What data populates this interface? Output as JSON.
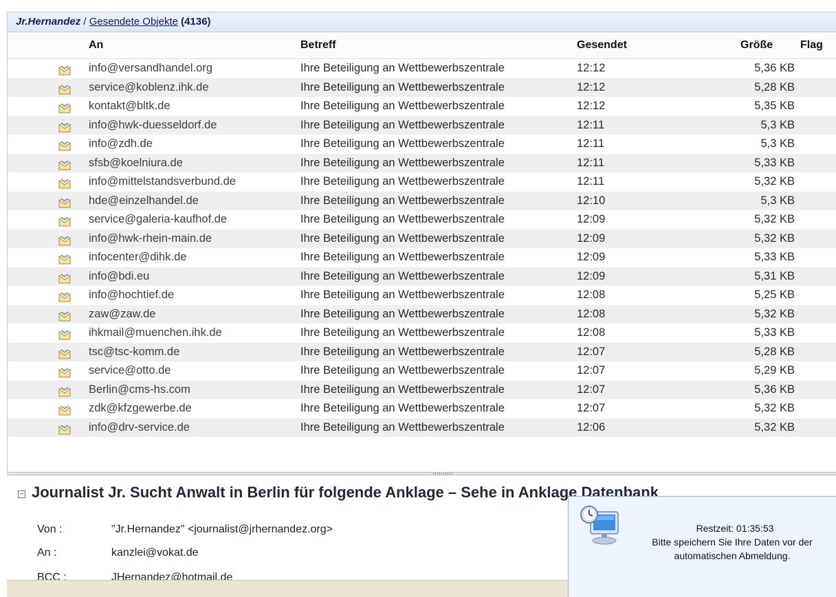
{
  "topbar": {
    "user": "Jr.Hernandez",
    "separator": " / ",
    "folder": "Gesendete Objekte",
    "count": "(4136)"
  },
  "columns": {
    "to": "An",
    "subject": "Betreff",
    "sent": "Gesendet",
    "size": "Größe",
    "flag": "Flag"
  },
  "messages": [
    {
      "to": "info@versandhandel.org",
      "subject": "Ihre Beteiligung an Wettbewerbszentrale",
      "sent": "12:12",
      "size": "5,36 KB"
    },
    {
      "to": "service@koblenz.ihk.de",
      "subject": "Ihre Beteiligung an Wettbewerbszentrale",
      "sent": "12:12",
      "size": "5,28 KB"
    },
    {
      "to": "kontakt@bltk.de",
      "subject": "Ihre Beteiligung an Wettbewerbszentrale",
      "sent": "12:12",
      "size": "5,35 KB"
    },
    {
      "to": "info@hwk-duesseldorf.de",
      "subject": "Ihre Beteiligung an Wettbewerbszentrale",
      "sent": "12:11",
      "size": "5,3 KB"
    },
    {
      "to": "info@zdh.de",
      "subject": "Ihre Beteiligung an Wettbewerbszentrale",
      "sent": "12:11",
      "size": "5,3 KB"
    },
    {
      "to": "sfsb@koelniura.de",
      "subject": "Ihre Beteiligung an Wettbewerbszentrale",
      "sent": "12:11",
      "size": "5,33 KB"
    },
    {
      "to": "info@mittelstandsverbund.de",
      "subject": "Ihre Beteiligung an Wettbewerbszentrale",
      "sent": "12:11",
      "size": "5,32 KB"
    },
    {
      "to": "hde@einzelhandel.de",
      "subject": "Ihre Beteiligung an Wettbewerbszentrale",
      "sent": "12:10",
      "size": "5,3 KB"
    },
    {
      "to": "service@galeria-kaufhof.de",
      "subject": "Ihre Beteiligung an Wettbewerbszentrale",
      "sent": "12:09",
      "size": "5,32 KB"
    },
    {
      "to": "info@hwk-rhein-main.de",
      "subject": "Ihre Beteiligung an Wettbewerbszentrale",
      "sent": "12:09",
      "size": "5,32 KB"
    },
    {
      "to": "infocenter@dihk.de",
      "subject": "Ihre Beteiligung an Wettbewerbszentrale",
      "sent": "12:09",
      "size": "5,33 KB"
    },
    {
      "to": "info@bdi.eu",
      "subject": "Ihre Beteiligung an Wettbewerbszentrale",
      "sent": "12:09",
      "size": "5,31 KB"
    },
    {
      "to": "info@hochtief.de",
      "subject": "Ihre Beteiligung an Wettbewerbszentrale",
      "sent": "12:08",
      "size": "5,25 KB"
    },
    {
      "to": "zaw@zaw.de",
      "subject": "Ihre Beteiligung an Wettbewerbszentrale",
      "sent": "12:08",
      "size": "5,32 KB"
    },
    {
      "to": "ihkmail@muenchen.ihk.de",
      "subject": "Ihre Beteiligung an Wettbewerbszentrale",
      "sent": "12:08",
      "size": "5,33 KB"
    },
    {
      "to": "tsc@tsc-komm.de",
      "subject": "Ihre Beteiligung an Wettbewerbszentrale",
      "sent": "12:07",
      "size": "5,28 KB"
    },
    {
      "to": "service@otto.de",
      "subject": "Ihre Beteiligung an Wettbewerbszentrale",
      "sent": "12:07",
      "size": "5,29 KB"
    },
    {
      "to": "Berlin@cms-hs.com",
      "subject": "Ihre Beteiligung an Wettbewerbszentrale",
      "sent": "12:07",
      "size": "5,36 KB"
    },
    {
      "to": "zdk@kfzgewerbe.de",
      "subject": "Ihre Beteiligung an Wettbewerbszentrale",
      "sent": "12:07",
      "size": "5,32 KB"
    },
    {
      "to": "info@drv-service.de",
      "subject": "Ihre Beteiligung an Wettbewerbszentrale",
      "sent": "12:06",
      "size": "5,32 KB"
    }
  ],
  "preview": {
    "subject": "Journalist Jr. Sucht Anwalt in Berlin für folgende Anklage – Sehe in Anklage Datenbank",
    "from_label": "Von :",
    "from_value": "\"Jr.Hernandez\" <journalist@jrhernandez.org>",
    "to_label": "An :",
    "to_value": "kanzlei@vokat.de",
    "bcc_label": "BCC :",
    "bcc_value": "JHernandez@hotmail.de"
  },
  "popup": {
    "remaining": "Restzeit:  01:35:53",
    "message_line1": "Bitte speichern Sie Ihre Daten vor der",
    "message_line2": "automatischen Abmeldung."
  },
  "icons": {
    "message": "sent-mail-icon",
    "popup": "session-timer-computer-icon",
    "collapse": "collapse-icon"
  }
}
